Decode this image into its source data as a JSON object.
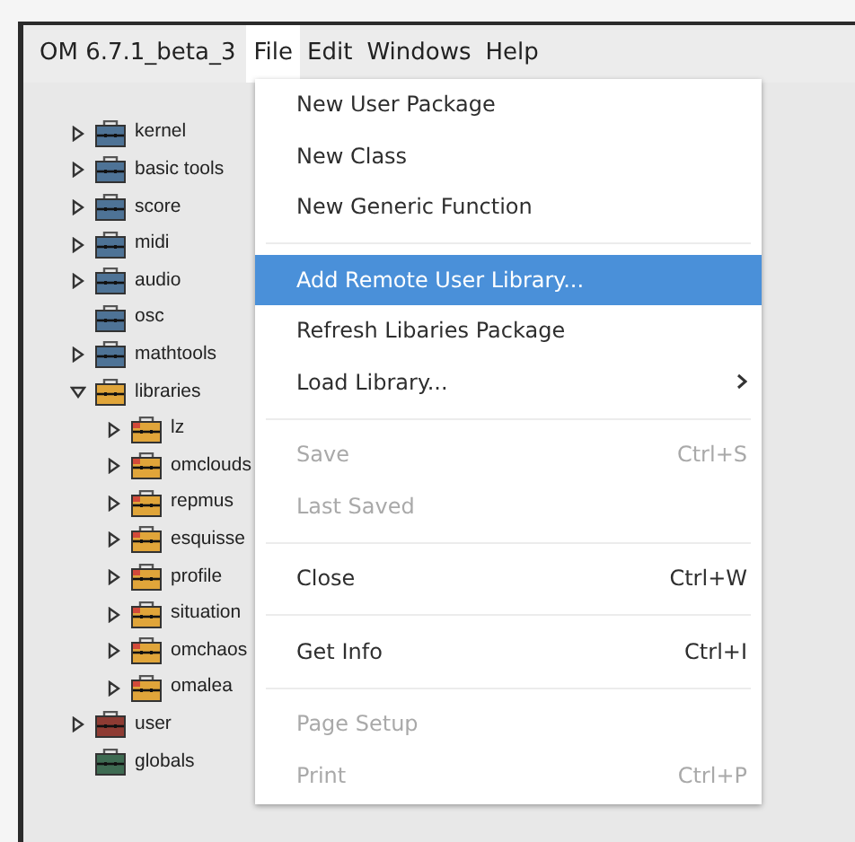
{
  "menubar": {
    "app_title": "OM 6.7.1_beta_3",
    "menus": [
      {
        "label": "File",
        "selected": true
      },
      {
        "label": "Edit",
        "selected": false
      },
      {
        "label": "Windows",
        "selected": false
      },
      {
        "label": "Help",
        "selected": false
      }
    ]
  },
  "tree": [
    {
      "label": "kernel",
      "kind": "collapsed",
      "color": "#4e7396"
    },
    {
      "label": "basic tools",
      "kind": "collapsed",
      "color": "#4e7396"
    },
    {
      "label": "score",
      "kind": "collapsed",
      "color": "#4e7396"
    },
    {
      "label": "midi",
      "kind": "collapsed",
      "color": "#4e7396"
    },
    {
      "label": "audio",
      "kind": "collapsed",
      "color": "#4e7396"
    },
    {
      "label": "osc",
      "kind": "leaf",
      "color": "#4e7396"
    },
    {
      "label": "mathtools",
      "kind": "collapsed",
      "color": "#4e7396"
    },
    {
      "label": "libraries",
      "kind": "expanded",
      "color": "#e0a53a",
      "children": [
        {
          "label": "lz",
          "kind": "collapsed",
          "color": "#e0a53a"
        },
        {
          "label": "omclouds",
          "kind": "collapsed",
          "color": "#e0a53a"
        },
        {
          "label": "repmus",
          "kind": "collapsed",
          "color": "#e0a53a"
        },
        {
          "label": "esquisse",
          "kind": "collapsed",
          "color": "#e0a53a"
        },
        {
          "label": "profile",
          "kind": "collapsed",
          "color": "#e0a53a"
        },
        {
          "label": "situation",
          "kind": "collapsed",
          "color": "#e0a53a"
        },
        {
          "label": "omchaos",
          "kind": "collapsed",
          "color": "#e0a53a"
        },
        {
          "label": "omalea",
          "kind": "collapsed",
          "color": "#e0a53a"
        }
      ]
    },
    {
      "label": "user",
      "kind": "collapsed",
      "color": "#8e3b33"
    },
    {
      "label": "globals",
      "kind": "leaf",
      "color": "#3e6b52"
    }
  ],
  "file_menu": [
    {
      "kind": "item",
      "label": "New User Package",
      "disabled": false,
      "selected": false
    },
    {
      "kind": "item",
      "label": "New Class",
      "disabled": false,
      "selected": false
    },
    {
      "kind": "item",
      "label": "New Generic Function",
      "disabled": false,
      "selected": false
    },
    {
      "kind": "separator"
    },
    {
      "kind": "item",
      "label": "Add Remote User Library...",
      "disabled": false,
      "selected": true
    },
    {
      "kind": "item",
      "label": "Refresh Libaries Package",
      "disabled": false,
      "selected": false
    },
    {
      "kind": "submenu",
      "label": "Load Library...",
      "disabled": false,
      "selected": false
    },
    {
      "kind": "separator"
    },
    {
      "kind": "item",
      "label": "Save",
      "shortcut": "Ctrl+S",
      "disabled": true,
      "selected": false
    },
    {
      "kind": "item",
      "label": "Last Saved",
      "disabled": true,
      "selected": false
    },
    {
      "kind": "separator"
    },
    {
      "kind": "item",
      "label": "Close",
      "shortcut": "Ctrl+W",
      "disabled": false,
      "selected": false
    },
    {
      "kind": "separator"
    },
    {
      "kind": "item",
      "label": "Get Info",
      "shortcut": "Ctrl+I",
      "disabled": false,
      "selected": false
    },
    {
      "kind": "separator"
    },
    {
      "kind": "item",
      "label": "Page Setup",
      "disabled": true,
      "selected": false
    },
    {
      "kind": "item",
      "label": "Print",
      "shortcut": "Ctrl+P",
      "disabled": true,
      "selected": false
    }
  ]
}
